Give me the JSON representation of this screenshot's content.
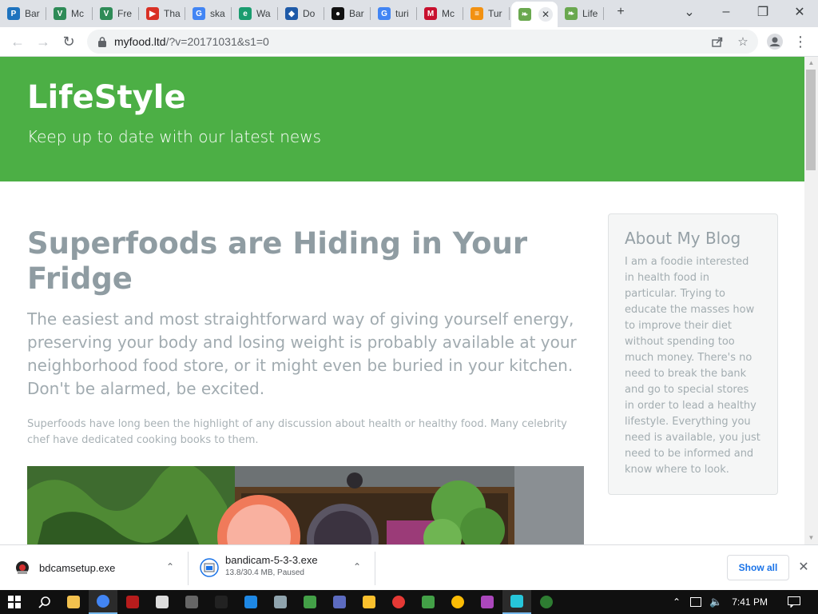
{
  "browser": {
    "tabs": [
      {
        "title": "Bar",
        "favicon": "p-icon",
        "color": "#1e73be",
        "glyph": "P"
      },
      {
        "title": "Mc",
        "favicon": "checkmark-v-icon",
        "color": "#2e8b57",
        "glyph": "V"
      },
      {
        "title": "Fre",
        "favicon": "checkmark-v-icon",
        "color": "#2e8b57",
        "glyph": "V"
      },
      {
        "title": "Tha",
        "favicon": "play-icon",
        "color": "#d93025",
        "glyph": "▶"
      },
      {
        "title": "ska",
        "favicon": "google-icon",
        "color": "#4285f4",
        "glyph": "G"
      },
      {
        "title": "Wa",
        "favicon": "edge-icon",
        "color": "#1a9c6f",
        "glyph": "e"
      },
      {
        "title": "Do",
        "favicon": "diamond-icon",
        "color": "#1e5aa8",
        "glyph": "◆"
      },
      {
        "title": "Bar",
        "favicon": "record-icon",
        "color": "#111111",
        "glyph": "●"
      },
      {
        "title": "turi",
        "favicon": "google-icon",
        "color": "#4285f4",
        "glyph": "G"
      },
      {
        "title": "Mc",
        "favicon": "mcafee-shield-icon",
        "color": "#c8102e",
        "glyph": "M"
      },
      {
        "title": "Tur",
        "favicon": "stack-icon",
        "color": "#f29111",
        "glyph": "≡"
      },
      {
        "title": "",
        "favicon": "lifestyle-leaf-icon",
        "color": "#6aa84f",
        "glyph": "❧"
      },
      {
        "title": "Life",
        "favicon": "lifestyle-leaf-icon",
        "color": "#6aa84f",
        "glyph": "❧"
      }
    ],
    "url_host": "myfood.ltd",
    "url_path": "/?v=20171031&s1=0"
  },
  "page": {
    "site_title": "LifeStyle",
    "tagline": "Keep up to date with our latest news",
    "article": {
      "title": "Superfoods are Hiding in Your Fridge",
      "lead": "The easiest and most straightforward way of giving yourself energy, preserving your body and losing weight is probably available at your neighborhood food store, or it might even be buried in your kitchen. Don't be alarmed, be excited.",
      "body": "Superfoods have long been the highlight of any discussion about health or healthy food. Many celebrity chef have dedicated cooking books to them."
    },
    "sidebar": {
      "title": "About My Blog",
      "text": "I am a foodie interested in health food in particular. Trying to educate the masses how to improve their diet without spending too much money. There's no need to break the bank and go to special stores in order to lead a healthy lifestyle. Everything you need is available, you just need to be informed and know where to look."
    },
    "header_color": "#4caf45"
  },
  "downloads": {
    "items": [
      {
        "name": "bdcamsetup.exe",
        "status": ""
      },
      {
        "name": "bandicam-5-3-3.exe",
        "status": "13.8/30.4 MB, Paused"
      }
    ],
    "show_all_label": "Show all"
  },
  "taskbar": {
    "time": "7:41 PM",
    "apps": [
      {
        "name": "file-explorer-icon",
        "color": "#f2c14e"
      },
      {
        "name": "chrome-icon",
        "color": "#4285f4"
      },
      {
        "name": "bandicam-icon",
        "color": "#b71c1c"
      },
      {
        "name": "security-shield-icon",
        "color": "#dddddd"
      },
      {
        "name": "calculator-icon",
        "color": "#666666"
      },
      {
        "name": "terminal-icon",
        "color": "#222222"
      },
      {
        "name": "window-app-icon",
        "color": "#1e88e5"
      },
      {
        "name": "image-viewer-icon",
        "color": "#90a4ae"
      },
      {
        "name": "bug-icon",
        "color": "#43a047"
      },
      {
        "name": "remote-desktop-icon",
        "color": "#5c6bc0"
      },
      {
        "name": "notes-icon",
        "color": "#fbc02d"
      },
      {
        "name": "opera-icon",
        "color": "#e53935"
      },
      {
        "name": "torrent-icon",
        "color": "#43a047"
      },
      {
        "name": "chrome-alt-icon",
        "color": "#fbbc05"
      },
      {
        "name": "media-app-icon",
        "color": "#ab47bc"
      },
      {
        "name": "snip-tool-icon",
        "color": "#26c6da"
      },
      {
        "name": "edge-dev-icon",
        "color": "#2e7d32"
      }
    ]
  }
}
